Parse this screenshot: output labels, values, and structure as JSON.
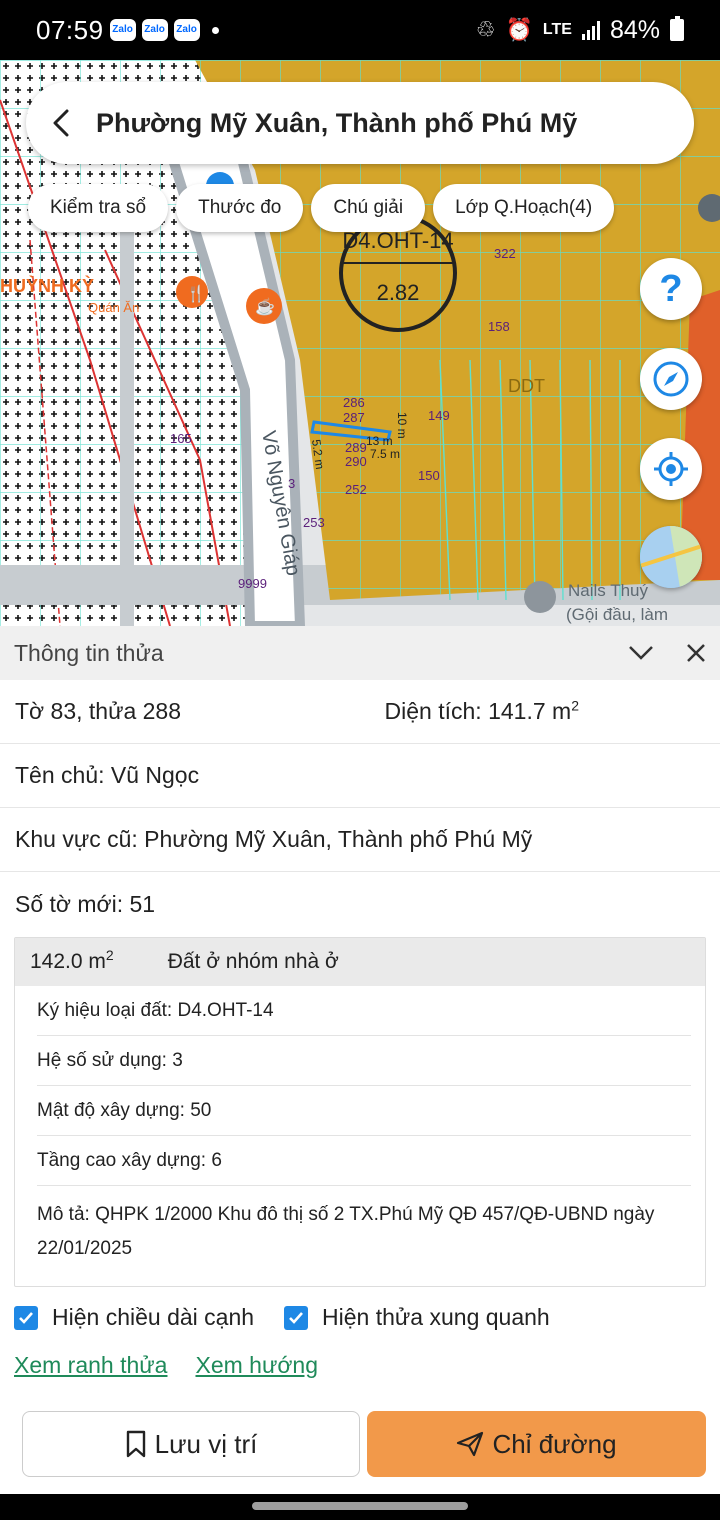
{
  "status_bar": {
    "time": "07:59",
    "notification_icons": [
      "Zalo",
      "Zalo",
      "Zalo"
    ],
    "network": "LTE",
    "battery": "84%"
  },
  "map": {
    "title": "Phường Mỹ Xuân, Thành phố Phú Mỹ",
    "chips": [
      "Kiểm tra sổ",
      "Thước đo",
      "Chú giải",
      "Lớp Q.Hoạch(4)"
    ],
    "help_label": "?",
    "labels": {
      "zone_code": "D4.OHT-14",
      "zone_coef": "2.82",
      "street": "Võ Nguyên Giáp",
      "parcels": [
        "322",
        "158",
        "286",
        "287",
        "289",
        "290",
        "149",
        "150",
        "252",
        "253",
        "165",
        "9999",
        "3"
      ],
      "dims": [
        "5.2 m",
        "13 m",
        "10 m",
        "7.5 m"
      ],
      "poi_left": "HUỲNH KỲ",
      "poi_left_sub": "Quán Ăn",
      "poi_right": "Nails Thuý",
      "poi_right_sub": "(Gội đầu, làm",
      "zone_right": "DDT"
    },
    "colors": {
      "zone_yellow": "#d4a52a",
      "zone_orange": "#e0602a",
      "grid_cyan": "#5fe0d0",
      "road": "#b0b8bf"
    }
  },
  "panel": {
    "header_title": "Thông tin thửa",
    "sheet_parcel": "Tờ 83, thửa 288",
    "area_label": "Diện tích: 141.7 m",
    "area_sup": "2",
    "owner": "Tên chủ: Vũ Ngọc",
    "old_area": "Khu vực cũ: Phường Mỹ Xuân, Thành phố Phú Mỹ",
    "new_sheet": "Số tờ mới: 51",
    "zone": {
      "area": "142.0 m",
      "area_sup": "2",
      "type": "Đất ở nhóm nhà ở",
      "symbol": "Ký hiệu loại đất: D4.OHT-14",
      "usage_coef": "Hệ số sử dụng: 3",
      "density": "Mật độ xây dựng: 50",
      "floors": "Tầng cao xây dựng: 6",
      "description": "Mô tả: QHPK 1/2000 Khu đô thị số 2 TX.Phú Mỹ QĐ 457/QĐ-UBND ngày 22/01/2025"
    },
    "checkbox_edges": "Hiện chiều dài cạnh",
    "checkbox_neighbors": "Hiện thửa xung quanh",
    "link_boundary": "Xem ranh thửa",
    "link_direction": "Xem hướng",
    "save_button": "Lưu vị trí",
    "directions_button": "Chỉ đường"
  }
}
